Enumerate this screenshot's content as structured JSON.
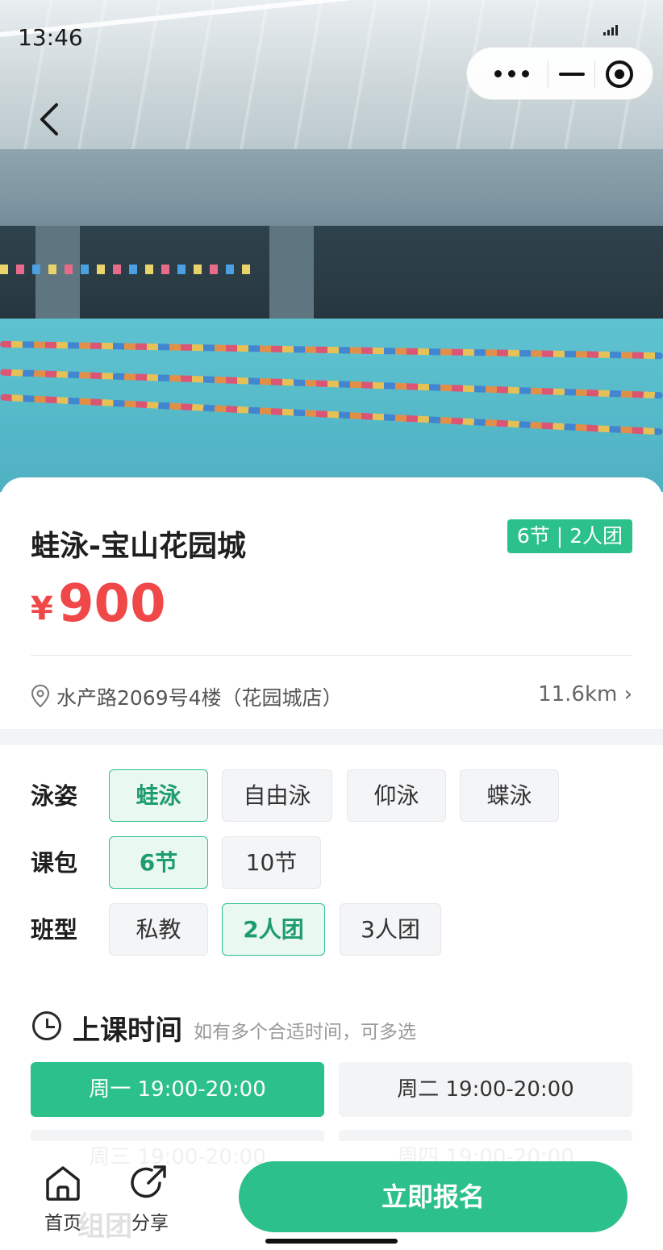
{
  "status_bar": {
    "time": "13:46"
  },
  "product": {
    "title": "蛙泳-宝山花园城",
    "package_badge": "6节 | 2人团",
    "price_symbol": "¥",
    "price": "900",
    "address": "水产路2069号4楼（花园城店）",
    "distance": "11.6km ›"
  },
  "options": {
    "stroke": {
      "label": "泳姿",
      "choices": [
        "蛙泳",
        "自由泳",
        "仰泳",
        "蝶泳"
      ],
      "selected": "蛙泳"
    },
    "package": {
      "label": "课包",
      "choices": [
        "6节",
        "10节"
      ],
      "selected": "6节"
    },
    "class_type": {
      "label": "班型",
      "choices": [
        "私教",
        "2人团",
        "3人团"
      ],
      "selected": "2人团"
    }
  },
  "schedule": {
    "title": "上课时间",
    "hint": "如有多个合适时间，可多选",
    "slots": [
      "周一 19:00-20:00",
      "周二 19:00-20:00",
      "周三 19:00-20:00",
      "周四 19:00-20:00"
    ],
    "selected": [
      "周一 19:00-20:00"
    ]
  },
  "bottom_bar": {
    "home_label": "首页",
    "share_label": "分享",
    "signup_label": "立即报名",
    "partial_title": "组团"
  },
  "colors": {
    "accent": "#2cc08b",
    "price": "#f04848"
  }
}
